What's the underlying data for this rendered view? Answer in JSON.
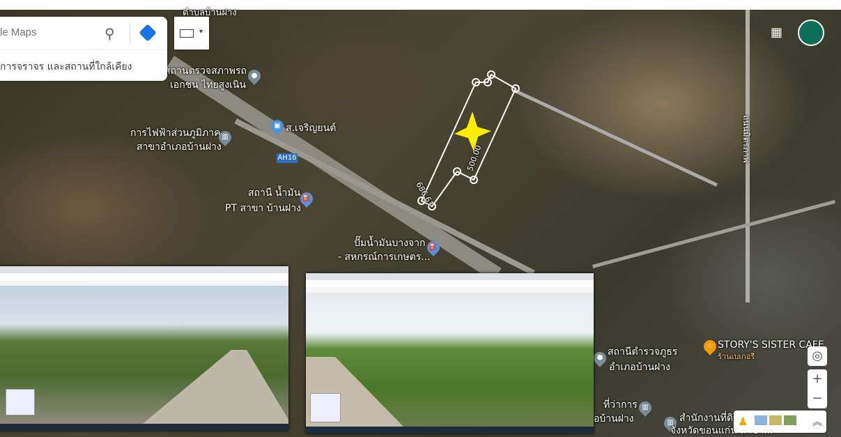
{
  "search": {
    "placeholder": "le Maps"
  },
  "chip": {
    "label": "การจราจร และสถานที่ใกล้เคียง"
  },
  "map_labels": {
    "top": "ตำบลบ้านฝาง",
    "inspection": "สถานตรวจสภาพรถ",
    "inspection2": "เอกชน ไทยสูงเนิน",
    "shop": "ส.เจริญยนต์",
    "pea": "การไฟฟ้าส่วนภูมิภาค",
    "pea2": "สาขาอำเภอบ้านฝาง",
    "highway": "AH16",
    "pt": "สถานี น้ำมัน",
    "pt2": "PT สาขา บ้านฝาง",
    "coop": "ปั๊มน้ำมันบางจาก",
    "coop2": "- สหกรณ์การเกษตร...",
    "police": "สถานีตำรวจภูธร",
    "police2": "อำเภอบ้านฝาง",
    "cafe": "STORY'S SISTER CAFE",
    "cafe2": "ร้านเบเกอรี่",
    "district": "ที่ว่าการ",
    "district2": "อบ้านฝาง",
    "office": "สำนักงานที่ดิน",
    "office2": "จังหวัดขอนแก่น สาขา...",
    "road_right": "ถนนมิตรภาพ"
  },
  "measurements": {
    "side_a": "500.00",
    "side_b": "686.61"
  },
  "controls": {
    "zoom_in": "+",
    "zoom_out": "−"
  },
  "colors": {
    "accent": "#1a73e8",
    "pin": "#4a90d9",
    "marker": "#ffee00"
  }
}
